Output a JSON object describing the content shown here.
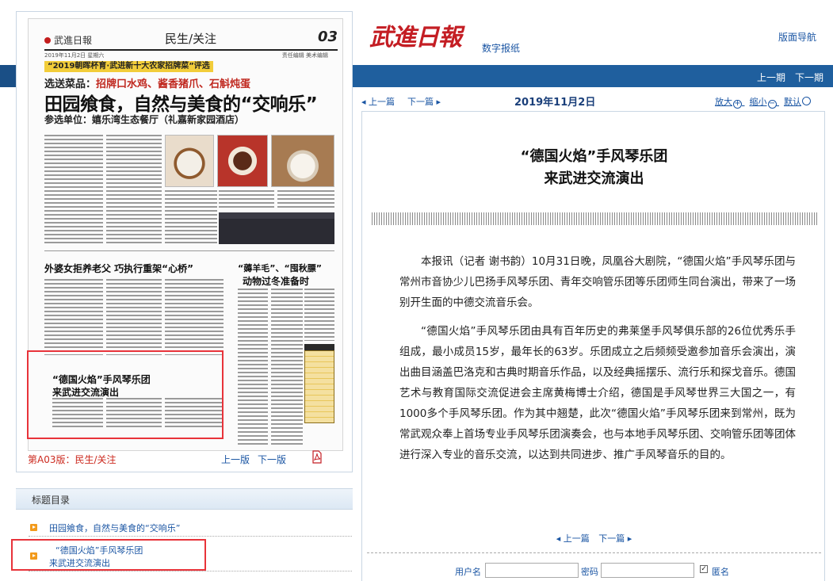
{
  "paper": {
    "logo_text": "武進日報",
    "section": "民生/关注",
    "page_no": "03",
    "date_line": "2019年11月2日 星期六",
    "credit_line": "责任编辑 美术编辑",
    "banner": "“2019朝晖杯育·武进新十大农家招牌菜”评选",
    "kicker_prefix": "选送菜品：",
    "kicker_dishes": "招牌口水鸡、酱香猪爪、石斛炖蛋",
    "headline": "田园飨食，自然与美食的“交响乐”",
    "sub": "参选单位：嬉乐湾生态餐厅（礼嘉新家园酒店）",
    "h_left": "外婆女拒养老父 巧执行重架“心桥”",
    "h_right_1": "“薅羊毛”、“囤秋膘”",
    "h_right_2": "动物过冬准备时",
    "h_box_1": "“德国火焰”手风琴乐团",
    "h_box_2": "来武进交流演出"
  },
  "left_footer": {
    "page_label": "第A03版：民生/关注",
    "prev_page": "上一版",
    "next_page": "下一版"
  },
  "index": {
    "title": "标题目录",
    "items": [
      "田园飨食，自然与美食的“交响乐”",
      "“德国火焰”手风琴乐团",
      "来武进交流演出"
    ]
  },
  "header": {
    "logo": "武進日報",
    "subtitle": "数字报纸",
    "layout_nav": "版面导航",
    "prev_issue": "上一期",
    "next_issue": "下一期"
  },
  "toolbar": {
    "prev_article": "◂ 上一篇",
    "next_article": "下一篇 ▸",
    "date": "2019年11月2日",
    "zoom_in": "放大",
    "zoom_out": "缩小",
    "zoom_default": "默认"
  },
  "article": {
    "title_line1": "“德国火焰”手风琴乐团",
    "title_line2": "来武进交流演出",
    "para1": "本报讯（记者 谢书韵）10月31日晚，凤凰谷大剧院，“德国火焰”手风琴乐团与常州市音协少儿巴扬手风琴乐团、青年交响管乐团等乐团师生同台演出，带来了一场别开生面的中德交流音乐会。",
    "para2": "“德国火焰”手风琴乐团由具有百年历史的弗莱堡手风琴俱乐部的26位优秀乐手组成，最小成员15岁，最年长的63岁。乐团成立之后频频受邀参加音乐会演出，演出曲目涵盖巴洛克和古典时期音乐作品，以及经典摇摆乐、流行乐和探戈音乐。德国艺术与教育国际交流促进会主席黄梅博士介绍，德国是手风琴世界三大国之一，有1000多个手风琴乐团。作为其中翘楚，此次“德国火焰”手风琴乐团来到常州，既为常武观众奉上首场专业手风琴乐团演奏会，也与本地手风琴乐团、交响管乐团等团体进行深入专业的音乐交流，以达到共同进步、推广手风琴音乐的目的。",
    "bottom_prev": "◂ 上一篇",
    "bottom_next": "下一篇 ▸"
  },
  "login": {
    "user_label": "用户名",
    "password_label": "密码",
    "anonymous_label": "匿名"
  },
  "colors": {
    "brand_red": "#c41e24",
    "link_blue": "#1a55a3",
    "band_blue": "#1f5f9e",
    "highlight_red": "#e8333a"
  }
}
